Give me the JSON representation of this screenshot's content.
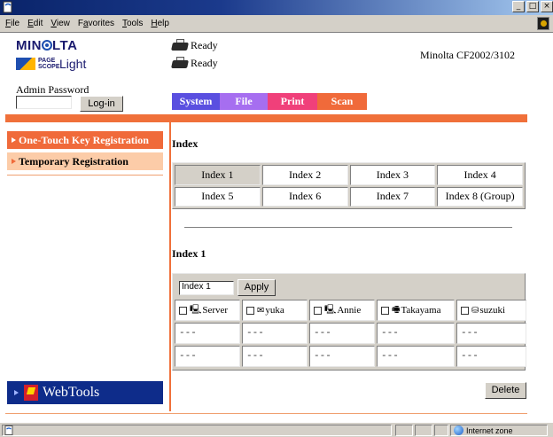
{
  "window": {
    "min_glyph": "_",
    "max_glyph": "□",
    "close_glyph": "×"
  },
  "menubar": {
    "items": [
      {
        "label": "File",
        "key": "F",
        "rest": "ile"
      },
      {
        "label": "Edit",
        "key": "E",
        "rest": "dit"
      },
      {
        "label": "View",
        "key": "V",
        "rest": "iew"
      },
      {
        "label": "Favorites",
        "key": "a",
        "pre": "F",
        "rest": "vorites"
      },
      {
        "label": "Tools",
        "key": "T",
        "rest": "ools"
      },
      {
        "label": "Help",
        "key": "H",
        "rest": "elp"
      }
    ]
  },
  "header": {
    "brand": "MIN",
    "brand_rest": "LTA",
    "product_line1": "PAGE",
    "product_line2": "SCOPE",
    "product_name": "Light",
    "status_1": "Ready",
    "status_2": "Ready",
    "model": "Minolta CF2002/3102",
    "admin_label": "Admin Password",
    "login_button": "Log-in"
  },
  "tabs": [
    {
      "label": "System",
      "color": "#5a4fe0"
    },
    {
      "label": "File",
      "color": "#a66ef0"
    },
    {
      "label": "Print",
      "color": "#f0407a"
    },
    {
      "label": "Scan",
      "color": "#f06a3a"
    }
  ],
  "sidebar": {
    "items": [
      {
        "label": "One-Touch Key Registration",
        "color": "#f06a3a"
      },
      {
        "label": "Temporary Registration",
        "color": "#fccca8"
      }
    ],
    "webtools": "WebTools"
  },
  "index_section": {
    "title": "Index",
    "indices": [
      "Index 1",
      "Index 2",
      "Index 3",
      "Index 4",
      "Index 5",
      "Index 6",
      "Index 7",
      "Index 8 (Group)"
    ],
    "active": "Index 1"
  },
  "entry_section": {
    "title": "Index 1",
    "name_value": "Index 1",
    "apply_button": "Apply",
    "destinations": [
      {
        "icon": "🖳",
        "icon_name": "computer-icon",
        "name": "Server"
      },
      {
        "icon": "✉",
        "icon_name": "mail-icon",
        "name": "yuka"
      },
      {
        "icon": "🖳",
        "icon_name": "computer-icon",
        "name": "Annie"
      },
      {
        "icon": "🖷",
        "icon_name": "fax-icon",
        "name": "Takayama"
      },
      {
        "icon": "⛁",
        "icon_name": "database-icon",
        "name": "suzuki"
      }
    ],
    "empty_rows": [
      [
        "---",
        "---",
        "---",
        "---",
        "---"
      ],
      [
        "---",
        "---",
        "---",
        "---",
        "---"
      ]
    ],
    "delete_button": "Delete"
  },
  "statusbar": {
    "zone": "Internet zone"
  }
}
